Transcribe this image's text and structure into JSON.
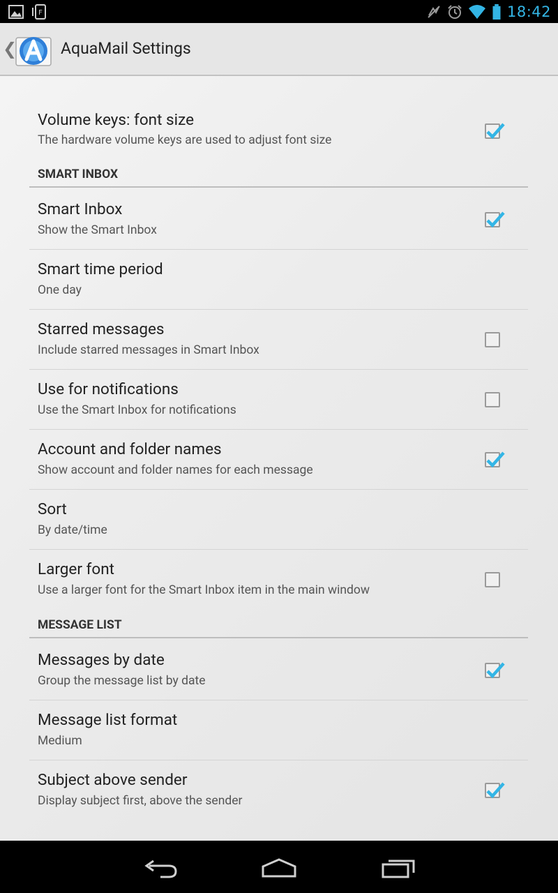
{
  "status_bar": {
    "time": "18:42",
    "left_icons": [
      "gallery-icon",
      "flipboard-icon"
    ],
    "right_icons": [
      "mute-icon",
      "alarm-icon",
      "wifi-icon",
      "battery-icon"
    ],
    "accent_color": "#33b5e5"
  },
  "action_bar": {
    "title": "AquaMail Settings",
    "up_caret": "❮"
  },
  "preferences": [
    {
      "title": "Volume keys: font size",
      "summary": "The hardware volume keys are used to adjust font size",
      "checkbox": true,
      "checked": true
    },
    {
      "section": "SMART INBOX"
    },
    {
      "title": "Smart Inbox",
      "summary": "Show the Smart Inbox",
      "checkbox": true,
      "checked": true
    },
    {
      "title": "Smart time period",
      "summary": "One day",
      "checkbox": false
    },
    {
      "title": "Starred messages",
      "summary": "Include starred messages in Smart Inbox",
      "checkbox": true,
      "checked": false
    },
    {
      "title": "Use for notifications",
      "summary": "Use the Smart Inbox for notifications",
      "checkbox": true,
      "checked": false
    },
    {
      "title": "Account and folder names",
      "summary": "Show account and folder names for each message",
      "checkbox": true,
      "checked": true
    },
    {
      "title": "Sort",
      "summary": "By date/time",
      "checkbox": false
    },
    {
      "title": "Larger font",
      "summary": "Use a larger font for the Smart Inbox item in the main window",
      "checkbox": true,
      "checked": false
    },
    {
      "section": "MESSAGE LIST"
    },
    {
      "title": "Messages by date",
      "summary": "Group the message list by date",
      "checkbox": true,
      "checked": true
    },
    {
      "title": "Message list format",
      "summary": "Medium",
      "checkbox": false
    },
    {
      "title": "Subject above sender",
      "summary": "Display subject first, above the sender",
      "checkbox": true,
      "checked": true
    }
  ],
  "nav_bar": {
    "buttons": [
      "back-icon",
      "home-icon",
      "recents-icon"
    ]
  }
}
